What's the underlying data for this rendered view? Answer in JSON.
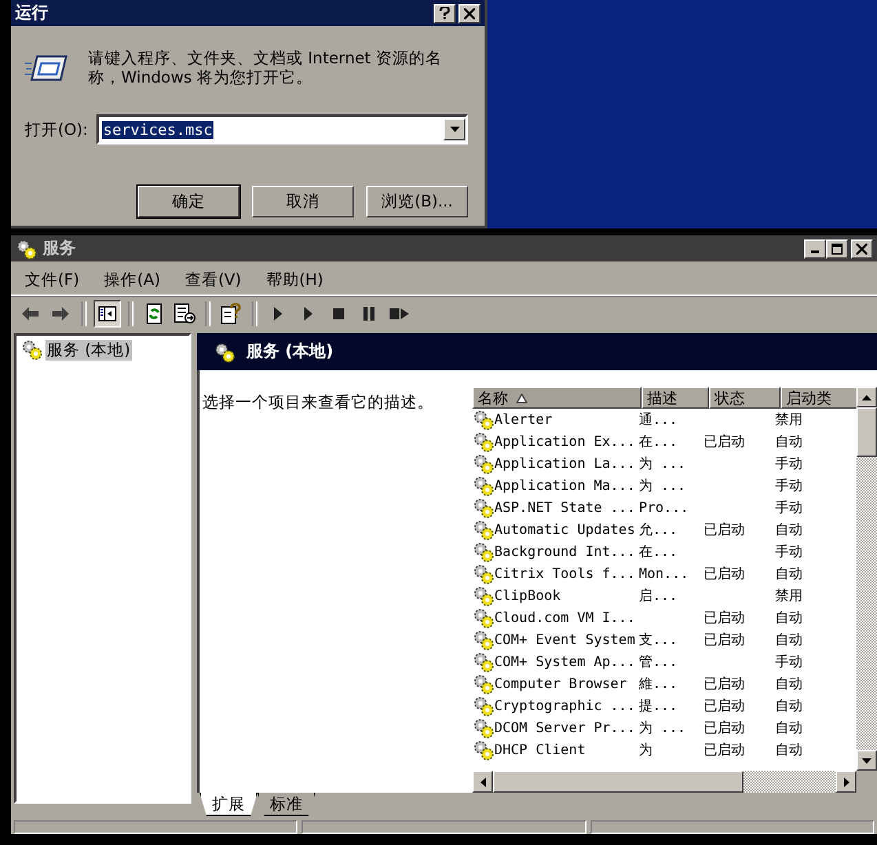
{
  "run_dialog": {
    "title": "运行",
    "prompt": "请键入程序、文件夹、文档或 Internet 资源的名称，Windows 将为您打开它。",
    "open_label": "打开(O):",
    "command": "services.msc",
    "buttons": [
      "确定",
      "取消",
      "浏览(B)..."
    ]
  },
  "services_window": {
    "title": "服务",
    "menu": [
      "文件(F)",
      "操作(A)",
      "查看(V)",
      "帮助(H)"
    ],
    "toolbar": [
      {
        "kind": "back"
      },
      {
        "kind": "forward"
      },
      {
        "kind": "separator"
      },
      {
        "kind": "tree",
        "pressed": true
      },
      {
        "kind": "separator"
      },
      {
        "kind": "refresh"
      },
      {
        "kind": "export"
      },
      {
        "kind": "separator"
      },
      {
        "kind": "help"
      },
      {
        "kind": "separator"
      },
      {
        "kind": "start"
      },
      {
        "kind": "start"
      },
      {
        "kind": "stop"
      },
      {
        "kind": "pause"
      },
      {
        "kind": "restart"
      }
    ],
    "tree": [
      {
        "label": "服务 (本地)",
        "selected": true
      }
    ],
    "panel_title": "服务 (本地)",
    "description_hint": "选择一个项目来查看它的描述。",
    "columns": [
      {
        "label": "名称",
        "sorted": true
      },
      {
        "label": "描述",
        "sorted": false
      },
      {
        "label": "状态",
        "sorted": false
      },
      {
        "label": "启动类",
        "sorted": false
      }
    ],
    "rows": [
      {
        "name": "Alerter",
        "description": "通...",
        "status": "",
        "startup": "禁用"
      },
      {
        "name": "Application Ex...",
        "description": "在...",
        "status": "已启动",
        "startup": "自动"
      },
      {
        "name": "Application La...",
        "description": "为 ...",
        "status": "",
        "startup": "手动"
      },
      {
        "name": "Application Ma...",
        "description": "为 ...",
        "status": "",
        "startup": "手动"
      },
      {
        "name": "ASP.NET State ...",
        "description": "Pro...",
        "status": "",
        "startup": "手动"
      },
      {
        "name": "Automatic Updates",
        "description": "允...",
        "status": "已启动",
        "startup": "自动"
      },
      {
        "name": "Background Int...",
        "description": "在...",
        "status": "",
        "startup": "手动"
      },
      {
        "name": "Citrix Tools f...",
        "description": "Mon...",
        "status": "已启动",
        "startup": "自动"
      },
      {
        "name": "ClipBook",
        "description": "启...",
        "status": "",
        "startup": "禁用"
      },
      {
        "name": "Cloud.com VM I...",
        "description": "",
        "status": "已启动",
        "startup": "自动"
      },
      {
        "name": "COM+ Event System",
        "description": "支...",
        "status": "已启动",
        "startup": "自动"
      },
      {
        "name": "COM+ System Ap...",
        "description": "管...",
        "status": "",
        "startup": "手动"
      },
      {
        "name": "Computer Browser",
        "description": "維...",
        "status": "已启动",
        "startup": "自动"
      },
      {
        "name": "Cryptographic ...",
        "description": "提...",
        "status": "已启动",
        "startup": "自动"
      },
      {
        "name": "DCOM Server Pr...",
        "description": "为 ...",
        "status": "已启动",
        "startup": "自动"
      },
      {
        "name": "DHCP Client",
        "description": "为",
        "status": "已启动",
        "startup": "自动"
      }
    ],
    "view_tabs": [
      {
        "label": "扩展",
        "selected": true
      },
      {
        "label": "标准",
        "selected": false
      }
    ]
  }
}
